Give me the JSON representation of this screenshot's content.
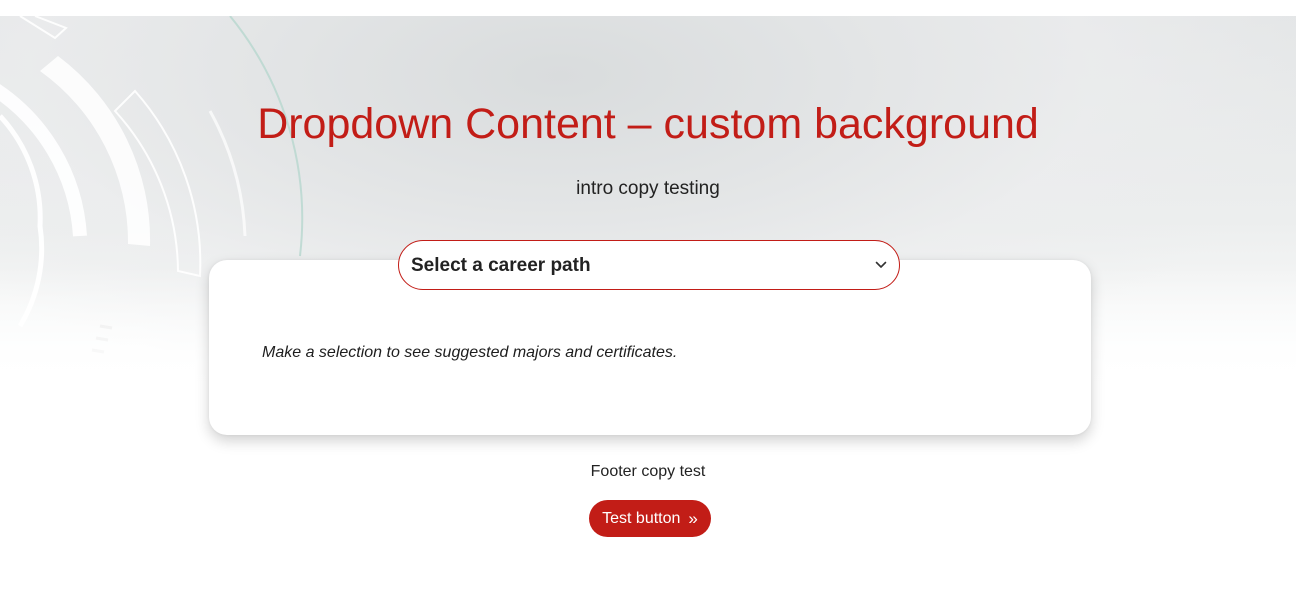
{
  "hero": {
    "title": "Dropdown Content – custom background",
    "intro": "intro copy testing"
  },
  "dropdown": {
    "selected_label": "Select a career path",
    "icon": "chevron-down-icon"
  },
  "card": {
    "message": "Make a selection to see suggested majors and certificates."
  },
  "footer": {
    "copy": "Footer copy test",
    "button_label": "Test button",
    "button_icon": "»"
  },
  "colors": {
    "accent": "#c21d17",
    "text": "#222222",
    "background": "#ffffff"
  }
}
